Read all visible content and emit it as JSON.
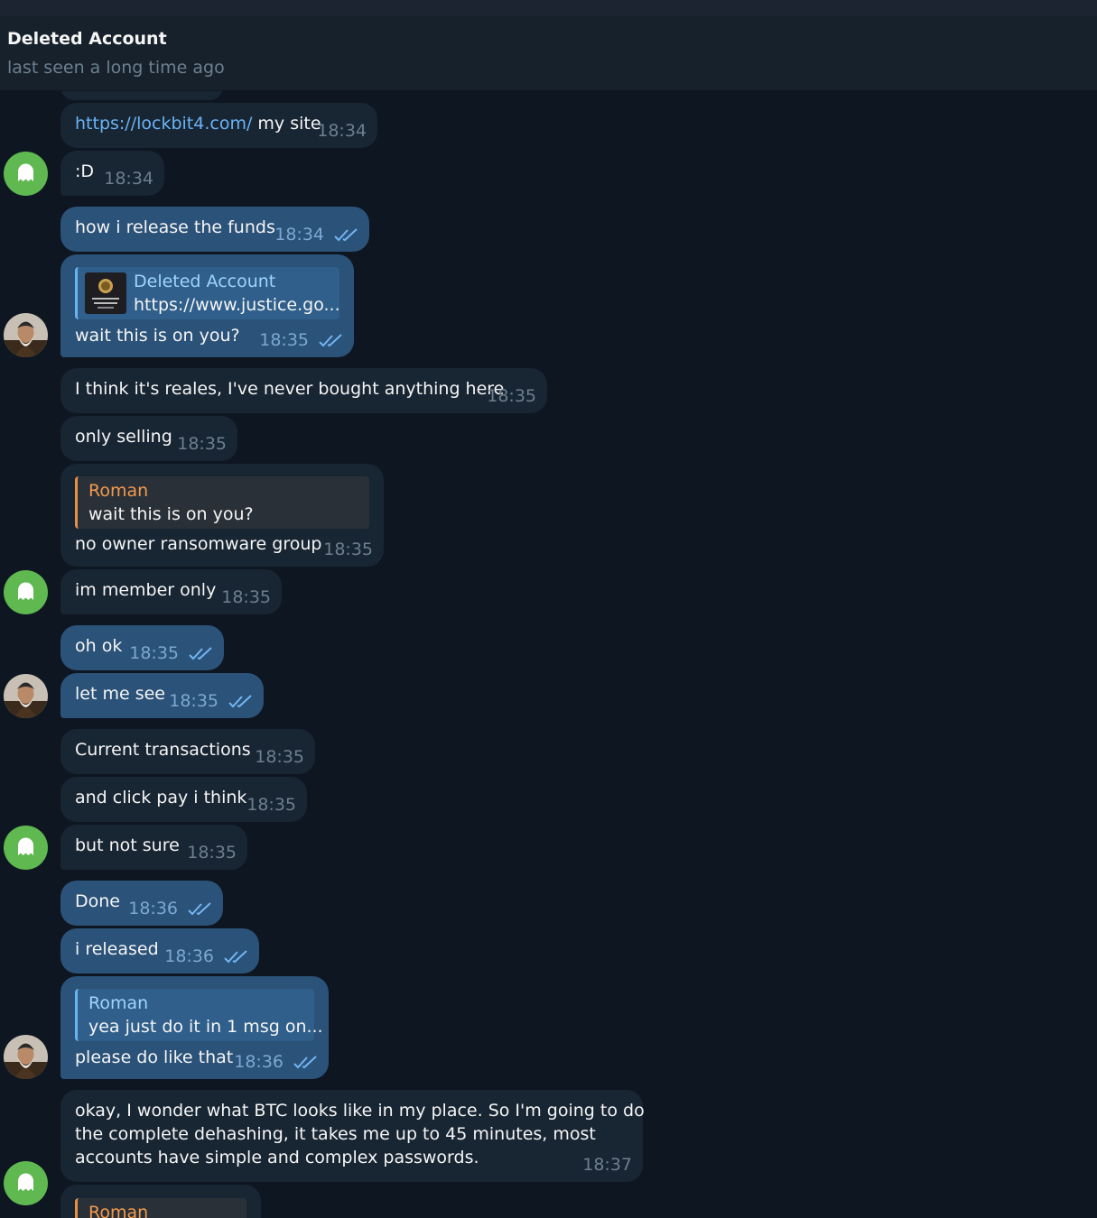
{
  "header": {
    "name": "Deleted Account",
    "status": "last seen a long time ago"
  },
  "messages": {
    "m1": {
      "link": "https://lockbit4.com/",
      "text": " my site",
      "time": "18:34"
    },
    "m2": {
      "text": ":D",
      "time": "18:34"
    },
    "m3": {
      "text": "how i release the funds",
      "time": "18:34"
    },
    "m4": {
      "quote_name": "Deleted Account",
      "quote_text": "https://www.justice.go...",
      "text": "wait this is on you?",
      "time": "18:35"
    },
    "m5": {
      "text": "I think it's reales, I've never bought anything here",
      "time": "18:35"
    },
    "m6": {
      "text": "only selling",
      "time": "18:35"
    },
    "m7": {
      "quote_name": "Roman",
      "quote_text": "wait this is on you?",
      "text": "no owner ransomware group",
      "time": "18:35"
    },
    "m8": {
      "text": "im member only",
      "time": "18:35"
    },
    "m9": {
      "text": "oh ok",
      "time": "18:35"
    },
    "m10": {
      "text": "let me see",
      "time": "18:35"
    },
    "m11": {
      "text": "Current transactions",
      "time": "18:35"
    },
    "m12": {
      "text": "and click pay i think",
      "time": "18:35"
    },
    "m13": {
      "text": "but not sure",
      "time": "18:35"
    },
    "m14": {
      "text": "Done",
      "time": "18:36"
    },
    "m15": {
      "text": "i released",
      "time": "18:36"
    },
    "m16": {
      "quote_name": "Roman",
      "quote_text": "yea just do it in 1 msg on...",
      "text": "please do like that",
      "time": "18:36"
    },
    "m17": {
      "line1": "okay, I wonder what BTC looks like in my place. So I'm going to do",
      "line2": "the complete dehashing, it takes me up to 45 minutes, most",
      "line3": "accounts have simple and complex passwords.",
      "time": "18:37"
    },
    "m18": {
      "quote_name": "Roman"
    }
  },
  "icons": {
    "read": "double-check-icon",
    "ghost": "ghost-avatar-icon",
    "photo": "user-photo-avatar"
  },
  "colors": {
    "background": "#0e1621",
    "incoming": "#182533",
    "outgoing": "#2b5278",
    "link": "#6ab3f3",
    "ghost_avatar": "#5fb850",
    "quote_orange": "#f49a4c"
  }
}
